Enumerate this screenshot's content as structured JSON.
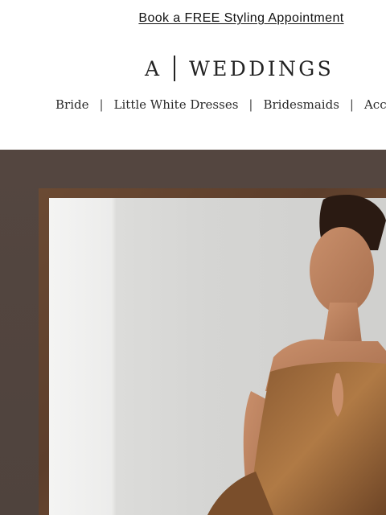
{
  "promo": {
    "link_text": "Book a FREE Styling Appointment"
  },
  "logo": {
    "letter": "A",
    "word": "WEDDINGS"
  },
  "nav": {
    "items": [
      {
        "label": "Bride"
      },
      {
        "label": "Little White Dresses"
      },
      {
        "label": "Bridesmaids"
      },
      {
        "label": "Acces"
      }
    ],
    "divider": "|"
  },
  "colors": {
    "hero_background": "#544640",
    "frame": "#6b4a33",
    "dress": "#8a5a32"
  }
}
